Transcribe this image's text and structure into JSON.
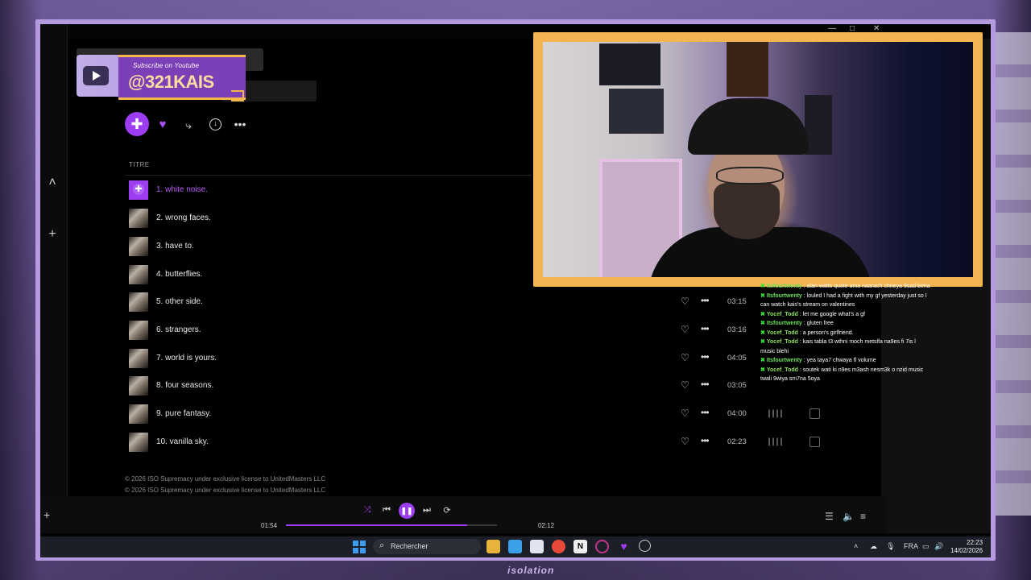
{
  "overlay": {
    "subscribe_small": "Subscribe on Youtube",
    "handle": "@321KAIS",
    "bottom_brand": "isolation"
  },
  "colors": {
    "accent": "#9d3df2",
    "cam_frame": "#f4b452",
    "overlay_purple": "#b49be0"
  },
  "window": {
    "minimize": "—",
    "maximize": "□",
    "close": "✕"
  },
  "rail": {
    "collapse_icon": "chevron-up-icon",
    "add_icon": "plus-icon"
  },
  "actions": {
    "play_icon": "play-icon",
    "like_icon": "heart-icon",
    "share_icon": "share-icon",
    "download_icon": "download-icon",
    "more_icon": "more-icon"
  },
  "tracklist": {
    "column_title": "TITRE",
    "tracks": [
      {
        "name": "1. white noise.",
        "active": true
      },
      {
        "name": "2. wrong faces."
      },
      {
        "name": "3. have to."
      },
      {
        "name": "4. butterflies."
      },
      {
        "name": "5. other side.",
        "duration": "03:15"
      },
      {
        "name": "6. strangers.",
        "duration": "03:16"
      },
      {
        "name": "7. world is yours.",
        "duration": "04:05"
      },
      {
        "name": "8. four seasons.",
        "duration": "03:05"
      },
      {
        "name": "9. pure fantasy.",
        "duration": "04:00"
      },
      {
        "name": "10. vanilla sky.",
        "duration": "02:23"
      }
    ]
  },
  "copyright": [
    "© 2026 ISO Supremacy under exclusive license to UnitedMasters LLC",
    "© 2026 ISO Supremacy under exclusive license to UnitedMasters LLC"
  ],
  "player": {
    "elapsed": "01:54",
    "total": "02:12",
    "progress": 0.86
  },
  "chat": [
    {
      "user": "Itsfourtwenty",
      "text": " : alan watts quote ama naarach chneya 9sad beha"
    },
    {
      "user": "Itsfourtwenty",
      "text": " : louled I had a fight with my gf yesterday just so I can watch kais's stream on valentines"
    },
    {
      "user": "Yocef_Todd",
      "text": " : let me google what's a gf"
    },
    {
      "user": "Itsfourtwenty",
      "text": " : gluten free"
    },
    {
      "user": "Yocef_Todd",
      "text": " : a person's girlfriend."
    },
    {
      "user": "Yocef_Todd",
      "text": " : kais tabla t3 wthni moch metslfa na9es fi 7is l music blehi"
    },
    {
      "user": "Itsfourtwenty",
      "text": " : yea taya7 chwaya fl volume"
    },
    {
      "user": "Yocef_Todd",
      "text": " : soutek wati ki n9es m3ash nesm3k o nzid music twali 9wiya sm7na 5oya"
    }
  ],
  "taskbar": {
    "search_placeholder": "Rechercher",
    "lang": "FRA",
    "time": "22:23",
    "date": "14/02/2026"
  }
}
